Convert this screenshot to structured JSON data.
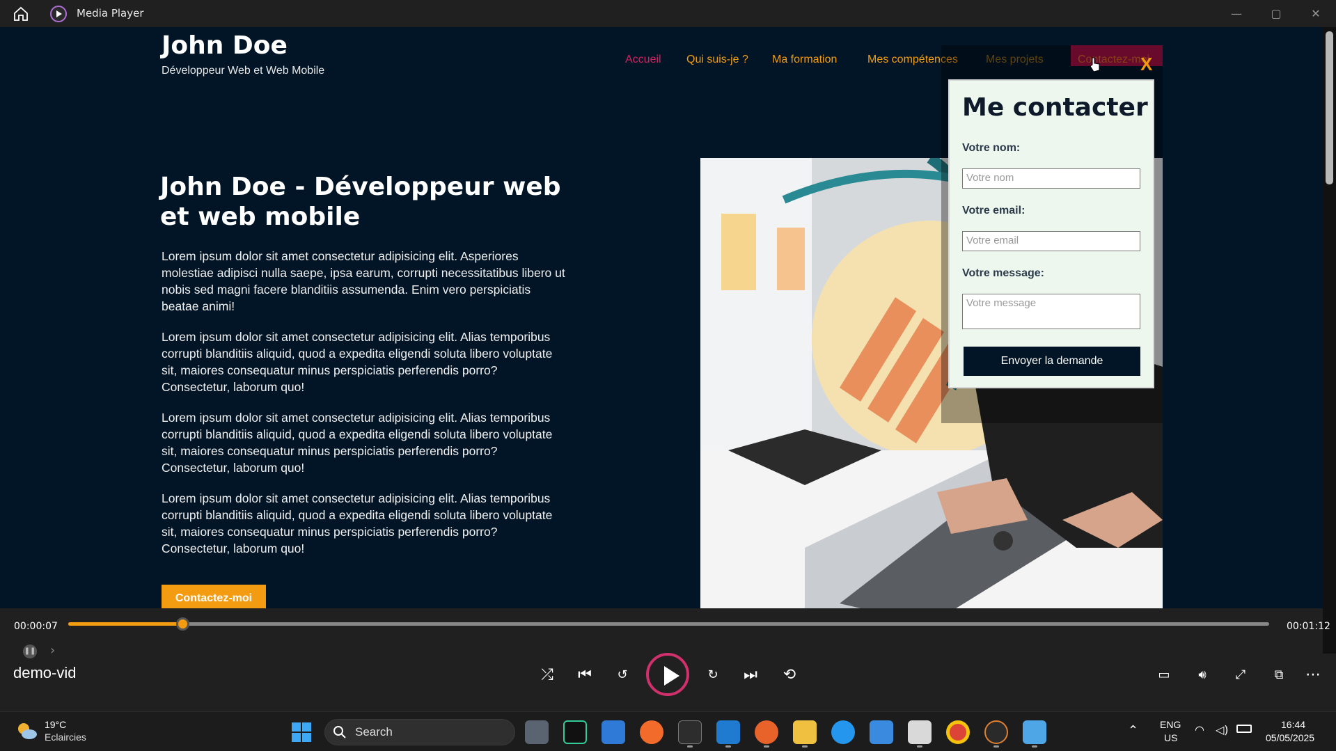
{
  "window": {
    "title": "Media Player",
    "min": "—",
    "max": "▢",
    "close": "✕"
  },
  "site": {
    "name": "John Doe",
    "tagline": "Développeur Web et Web Mobile",
    "nav": [
      {
        "label": "Accueil",
        "color": "#d0245f"
      },
      {
        "label": "Qui suis-je ?",
        "color": "#f39c12"
      },
      {
        "label": "Ma formation",
        "color": "#f39c12"
      },
      {
        "label": "Mes compétences",
        "color": "#f39c12"
      },
      {
        "label": "Mes projets",
        "color": "#f39c12"
      },
      {
        "label": "Contactez-moi",
        "color": "#f39c12"
      }
    ],
    "hero_title": "John Doe - Développeur web et web mobile",
    "paragraphs": [
      "Lorem ipsum dolor sit amet consectetur adipisicing elit. Asperiores molestiae adipisci nulla saepe, ipsa earum, corrupti necessitatibus libero ut nobis sed magni facere blanditiis assumenda. Enim vero perspiciatis beatae animi!",
      "Lorem ipsum dolor sit amet consectetur adipisicing elit. Alias temporibus corrupti blanditiis aliquid, quod a expedita eligendi soluta libero voluptate sit, maiores consequatur minus perspiciatis perferendis porro? Consectetur, laborum quo!",
      "Lorem ipsum dolor sit amet consectetur adipisicing elit. Alias temporibus corrupti blanditiis aliquid, quod a expedita eligendi soluta libero voluptate sit, maiores consequatur minus perspiciatis perferendis porro? Consectetur, laborum quo!",
      "Lorem ipsum dolor sit amet consectetur adipisicing elit. Alias temporibus corrupti blanditiis aliquid, quod a expedita eligendi soluta libero voluptate sit, maiores consequatur minus perspiciatis perferendis porro? Consectetur, laborum quo!"
    ],
    "cta": "Contactez-moi"
  },
  "modal": {
    "close": "X",
    "title": "Me contacter",
    "name_label": "Votre nom:",
    "name_placeholder": "Votre nom",
    "email_label": "Votre email:",
    "email_placeholder": "Votre email",
    "message_label": "Votre message:",
    "message_placeholder": "Votre message",
    "submit": "Envoyer la demande"
  },
  "player": {
    "current_time": "00:00:07",
    "total_time": "00:01:12",
    "progress_fraction": 0.095,
    "video_name": "demo-vid"
  },
  "taskbar": {
    "temperature": "19°C",
    "weather": "Eclaircies",
    "search_label": "Search",
    "language": "ENG",
    "region": "US",
    "time": "16:44",
    "date": "05/05/2025"
  },
  "colors": {
    "accent": "#f39c12",
    "nav_active_bg": "#a01042",
    "page_bg": "#021526"
  }
}
